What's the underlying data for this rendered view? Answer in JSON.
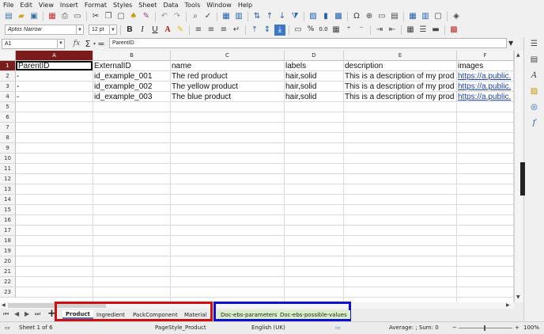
{
  "menu": [
    "File",
    "Edit",
    "View",
    "Insert",
    "Format",
    "Styles",
    "Sheet",
    "Data",
    "Tools",
    "Window",
    "Help"
  ],
  "toolbar": {
    "font_name": "Aptos Narrow",
    "font_size": "12 pt",
    "bold": "B",
    "italic": "I",
    "underline": "U",
    "percent": "%",
    "decimal": "0.0"
  },
  "formula_bar": {
    "name_box": "A1",
    "fx": "fx",
    "sum": "Σ",
    "equals": "=",
    "content": "ParentID"
  },
  "grid": {
    "columns": [
      "A",
      "B",
      "C",
      "D",
      "E",
      "F"
    ],
    "rows": [
      "1",
      "2",
      "3",
      "4",
      "5",
      "6",
      "7",
      "8",
      "9",
      "10",
      "11",
      "12",
      "13",
      "14",
      "15",
      "16",
      "17",
      "18",
      "19",
      "20",
      "21",
      "22",
      "23"
    ],
    "cells": [
      [
        "ParentID",
        "ExternalID",
        "name",
        "labels",
        "description",
        "images"
      ],
      [
        "-",
        "id_example_001",
        "The red product",
        "hair,solid",
        "This is a description of my prod",
        "https://a.public."
      ],
      [
        "-",
        "id_example_002",
        "The yellow product",
        "hair,solid",
        "This is a description of my prod",
        "https://a.public."
      ],
      [
        "-",
        "id_example_003",
        "The blue product",
        "hair,solid",
        "This is a description of my prod",
        "https://a.public."
      ]
    ]
  },
  "sheet_tabs": {
    "group_red": [
      "Product",
      "Ingredient",
      "PackComponent",
      "Material"
    ],
    "group_blue": [
      "Doc-ebs-parameters",
      "Doc-ebs-possible-values"
    ],
    "active": "Product",
    "add": "+"
  },
  "status": {
    "sheet": "Sheet 1 of 6",
    "page_style": "PageStyle_Product",
    "language": "English (UK)",
    "stats": "Average: ; Sum: 0",
    "zoom_minus": "−",
    "zoom_plus": "+",
    "zoom": "100%"
  },
  "colors": {
    "selected_header": "#7b1b1b",
    "red_box": "#d01010",
    "blue_box": "#1010d0",
    "link": "#1a3fc2",
    "tab_green": "#d9efc7"
  }
}
